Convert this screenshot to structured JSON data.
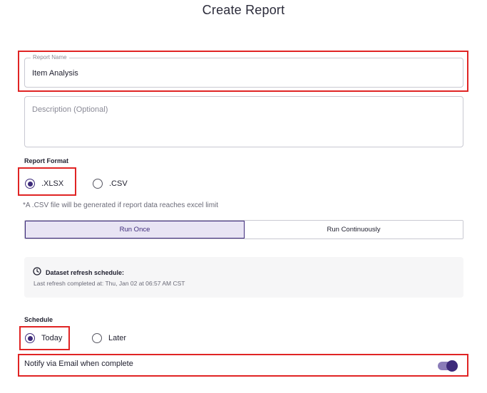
{
  "page": {
    "title": "Create Report"
  },
  "report_name": {
    "legend": "Report Name",
    "value": "Item Analysis"
  },
  "description": {
    "placeholder": "Description (Optional)"
  },
  "report_format": {
    "label": "Report Format",
    "options": [
      {
        "label": ".XLSX",
        "selected": true
      },
      {
        "label": ".CSV",
        "selected": false
      }
    ],
    "note": "*A .CSV file will be generated if report data reaches excel limit"
  },
  "run_mode": {
    "options": [
      {
        "label": "Run Once",
        "active": true
      },
      {
        "label": "Run Continuously",
        "active": false
      }
    ]
  },
  "dataset_refresh": {
    "icon": "clock-icon",
    "title": "Dataset refresh schedule:",
    "subtitle": "Last refresh completed at: Thu, Jan 02 at 06:57 AM CST"
  },
  "schedule": {
    "label": "Schedule",
    "options": [
      {
        "label": "Today",
        "selected": true
      },
      {
        "label": "Later",
        "selected": false
      }
    ]
  },
  "notify": {
    "label": "Notify via Email when complete",
    "enabled": true
  },
  "colors": {
    "accent": "#3d2a7a",
    "highlight": "#e02424",
    "info_bg": "#f6f6f7",
    "active_segment_bg": "#e8e4f4"
  }
}
